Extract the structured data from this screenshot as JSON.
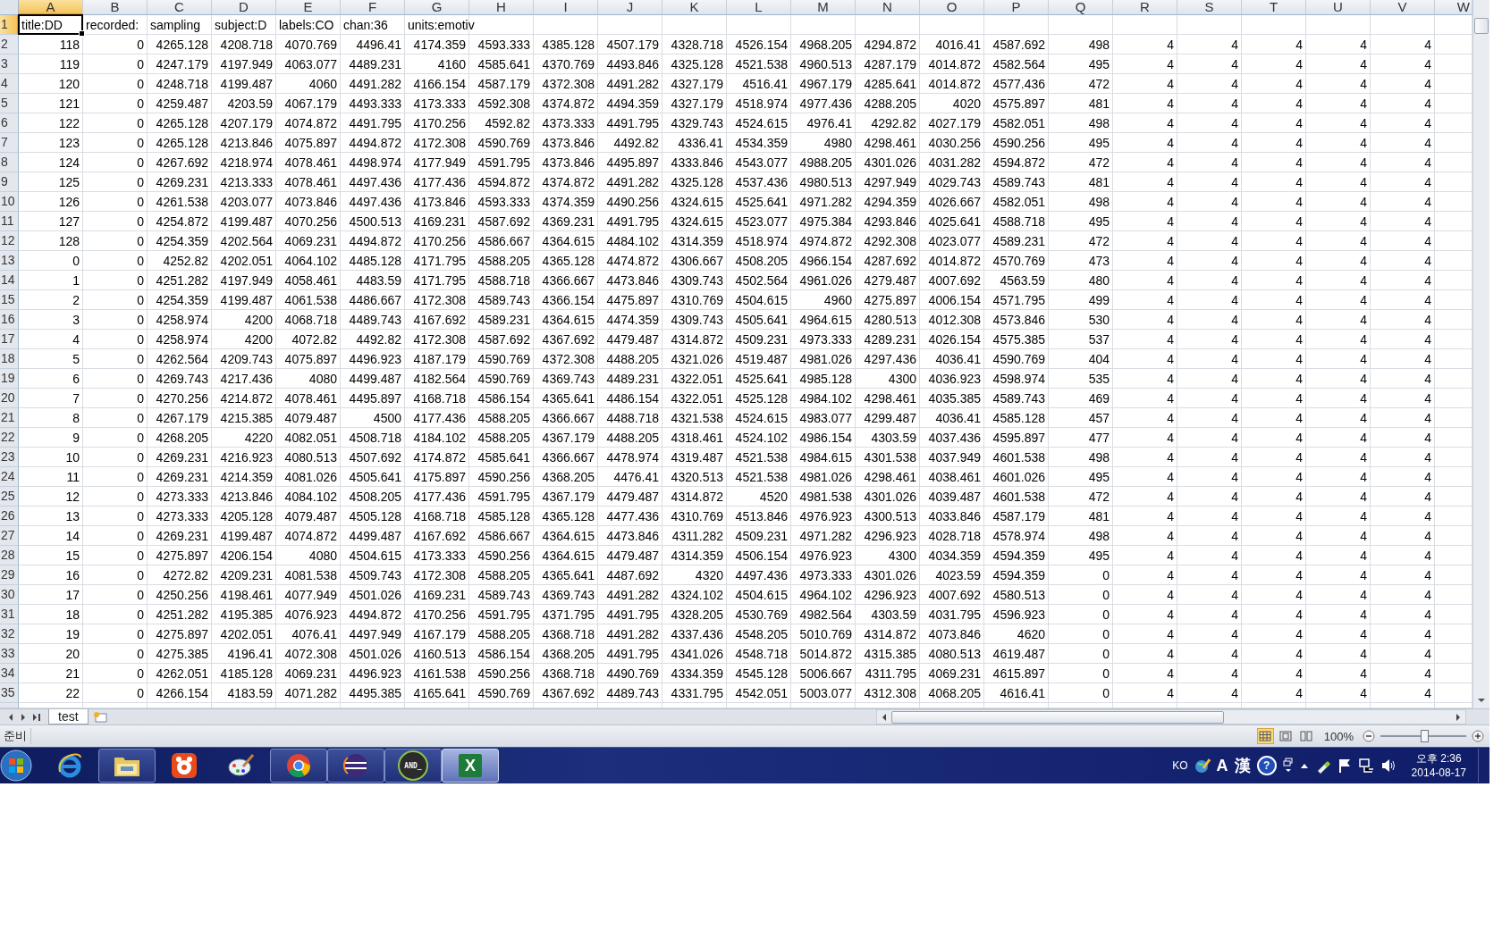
{
  "sheet": {
    "columns": [
      {
        "label": "A",
        "selected": true
      },
      {
        "label": "B",
        "selected": false
      },
      {
        "label": "C",
        "selected": false
      },
      {
        "label": "D",
        "selected": false
      },
      {
        "label": "E",
        "selected": false
      },
      {
        "label": "F",
        "selected": false
      },
      {
        "label": "G",
        "selected": false
      },
      {
        "label": "H",
        "selected": false
      },
      {
        "label": "I",
        "selected": false
      },
      {
        "label": "J",
        "selected": false
      },
      {
        "label": "K",
        "selected": false
      },
      {
        "label": "L",
        "selected": false
      },
      {
        "label": "M",
        "selected": false
      },
      {
        "label": "N",
        "selected": false
      },
      {
        "label": "O",
        "selected": false
      },
      {
        "label": "P",
        "selected": false
      },
      {
        "label": "Q",
        "selected": false
      },
      {
        "label": "R",
        "selected": false
      },
      {
        "label": "S",
        "selected": false
      },
      {
        "label": "T",
        "selected": false
      },
      {
        "label": "U",
        "selected": false
      },
      {
        "label": "V",
        "selected": false
      },
      {
        "label": "W",
        "selected": false
      }
    ],
    "rows": [
      {
        "label": "1",
        "selected": true,
        "kind": "text",
        "cells": [
          "title:DD",
          "recorded:",
          "sampling",
          "subject:D",
          "labels:CO",
          "chan:36",
          "units:emotiv"
        ]
      },
      {
        "label": "2",
        "selected": false,
        "kind": "number",
        "cells": [
          "118",
          "0",
          "4265.128",
          "4208.718",
          "4070.769",
          "4496.41",
          "4174.359",
          "4593.333",
          "4385.128",
          "4507.179",
          "4328.718",
          "4526.154",
          "4968.205",
          "4294.872",
          "4016.41",
          "4587.692",
          "498",
          "4",
          "4",
          "4",
          "4",
          "4"
        ]
      },
      {
        "label": "3",
        "selected": false,
        "kind": "number",
        "cells": [
          "119",
          "0",
          "4247.179",
          "4197.949",
          "4063.077",
          "4489.231",
          "4160",
          "4585.641",
          "4370.769",
          "4493.846",
          "4325.128",
          "4521.538",
          "4960.513",
          "4287.179",
          "4014.872",
          "4582.564",
          "495",
          "4",
          "4",
          "4",
          "4",
          "4"
        ]
      },
      {
        "label": "4",
        "selected": false,
        "kind": "number",
        "cells": [
          "120",
          "0",
          "4248.718",
          "4199.487",
          "4060",
          "4491.282",
          "4166.154",
          "4587.179",
          "4372.308",
          "4491.282",
          "4327.179",
          "4516.41",
          "4967.179",
          "4285.641",
          "4014.872",
          "4577.436",
          "472",
          "4",
          "4",
          "4",
          "4",
          "4"
        ]
      },
      {
        "label": "5",
        "selected": false,
        "kind": "number",
        "cells": [
          "121",
          "0",
          "4259.487",
          "4203.59",
          "4067.179",
          "4493.333",
          "4173.333",
          "4592.308",
          "4374.872",
          "4494.359",
          "4327.179",
          "4518.974",
          "4977.436",
          "4288.205",
          "4020",
          "4575.897",
          "481",
          "4",
          "4",
          "4",
          "4",
          "4"
        ]
      },
      {
        "label": "6",
        "selected": false,
        "kind": "number",
        "cells": [
          "122",
          "0",
          "4265.128",
          "4207.179",
          "4074.872",
          "4491.795",
          "4170.256",
          "4592.82",
          "4373.333",
          "4491.795",
          "4329.743",
          "4524.615",
          "4976.41",
          "4292.82",
          "4027.179",
          "4582.051",
          "498",
          "4",
          "4",
          "4",
          "4",
          "4"
        ]
      },
      {
        "label": "7",
        "selected": false,
        "kind": "number",
        "cells": [
          "123",
          "0",
          "4265.128",
          "4213.846",
          "4075.897",
          "4494.872",
          "4172.308",
          "4590.769",
          "4373.846",
          "4492.82",
          "4336.41",
          "4534.359",
          "4980",
          "4298.461",
          "4030.256",
          "4590.256",
          "495",
          "4",
          "4",
          "4",
          "4",
          "4"
        ]
      },
      {
        "label": "8",
        "selected": false,
        "kind": "number",
        "cells": [
          "124",
          "0",
          "4267.692",
          "4218.974",
          "4078.461",
          "4498.974",
          "4177.949",
          "4591.795",
          "4373.846",
          "4495.897",
          "4333.846",
          "4543.077",
          "4988.205",
          "4301.026",
          "4031.282",
          "4594.872",
          "472",
          "4",
          "4",
          "4",
          "4",
          "4"
        ]
      },
      {
        "label": "9",
        "selected": false,
        "kind": "number",
        "cells": [
          "125",
          "0",
          "4269.231",
          "4213.333",
          "4078.461",
          "4497.436",
          "4177.436",
          "4594.872",
          "4374.872",
          "4491.282",
          "4325.128",
          "4537.436",
          "4980.513",
          "4297.949",
          "4029.743",
          "4589.743",
          "481",
          "4",
          "4",
          "4",
          "4",
          "4"
        ]
      },
      {
        "label": "10",
        "selected": false,
        "kind": "number",
        "cells": [
          "126",
          "0",
          "4261.538",
          "4203.077",
          "4073.846",
          "4497.436",
          "4173.846",
          "4593.333",
          "4374.359",
          "4490.256",
          "4324.615",
          "4525.641",
          "4971.282",
          "4294.359",
          "4026.667",
          "4582.051",
          "498",
          "4",
          "4",
          "4",
          "4",
          "4"
        ]
      },
      {
        "label": "11",
        "selected": false,
        "kind": "number",
        "cells": [
          "127",
          "0",
          "4254.872",
          "4199.487",
          "4070.256",
          "4500.513",
          "4169.231",
          "4587.692",
          "4369.231",
          "4491.795",
          "4324.615",
          "4523.077",
          "4975.384",
          "4293.846",
          "4025.641",
          "4588.718",
          "495",
          "4",
          "4",
          "4",
          "4",
          "4"
        ]
      },
      {
        "label": "12",
        "selected": false,
        "kind": "number",
        "cells": [
          "128",
          "0",
          "4254.359",
          "4202.564",
          "4069.231",
          "4494.872",
          "4170.256",
          "4586.667",
          "4364.615",
          "4484.102",
          "4314.359",
          "4518.974",
          "4974.872",
          "4292.308",
          "4023.077",
          "4589.231",
          "472",
          "4",
          "4",
          "4",
          "4",
          "4"
        ]
      },
      {
        "label": "13",
        "selected": false,
        "kind": "number",
        "cells": [
          "0",
          "0",
          "4252.82",
          "4202.051",
          "4064.102",
          "4485.128",
          "4171.795",
          "4588.205",
          "4365.128",
          "4474.872",
          "4306.667",
          "4508.205",
          "4966.154",
          "4287.692",
          "4014.872",
          "4570.769",
          "473",
          "4",
          "4",
          "4",
          "4",
          "4"
        ]
      },
      {
        "label": "14",
        "selected": false,
        "kind": "number",
        "cells": [
          "1",
          "0",
          "4251.282",
          "4197.949",
          "4058.461",
          "4483.59",
          "4171.795",
          "4588.718",
          "4366.667",
          "4473.846",
          "4309.743",
          "4502.564",
          "4961.026",
          "4279.487",
          "4007.692",
          "4563.59",
          "480",
          "4",
          "4",
          "4",
          "4",
          "4"
        ]
      },
      {
        "label": "15",
        "selected": false,
        "kind": "number",
        "cells": [
          "2",
          "0",
          "4254.359",
          "4199.487",
          "4061.538",
          "4486.667",
          "4172.308",
          "4589.743",
          "4366.154",
          "4475.897",
          "4310.769",
          "4504.615",
          "4960",
          "4275.897",
          "4006.154",
          "4571.795",
          "499",
          "4",
          "4",
          "4",
          "4",
          "4"
        ]
      },
      {
        "label": "16",
        "selected": false,
        "kind": "number",
        "cells": [
          "3",
          "0",
          "4258.974",
          "4200",
          "4068.718",
          "4489.743",
          "4167.692",
          "4589.231",
          "4364.615",
          "4474.359",
          "4309.743",
          "4505.641",
          "4964.615",
          "4280.513",
          "4012.308",
          "4573.846",
          "530",
          "4",
          "4",
          "4",
          "4",
          "4"
        ]
      },
      {
        "label": "17",
        "selected": false,
        "kind": "number",
        "cells": [
          "4",
          "0",
          "4258.974",
          "4200",
          "4072.82",
          "4492.82",
          "4172.308",
          "4587.692",
          "4367.692",
          "4479.487",
          "4314.872",
          "4509.231",
          "4973.333",
          "4289.231",
          "4026.154",
          "4575.385",
          "537",
          "4",
          "4",
          "4",
          "4",
          "4"
        ]
      },
      {
        "label": "18",
        "selected": false,
        "kind": "number",
        "cells": [
          "5",
          "0",
          "4262.564",
          "4209.743",
          "4075.897",
          "4496.923",
          "4187.179",
          "4590.769",
          "4372.308",
          "4488.205",
          "4321.026",
          "4519.487",
          "4981.026",
          "4297.436",
          "4036.41",
          "4590.769",
          "404",
          "4",
          "4",
          "4",
          "4",
          "4"
        ]
      },
      {
        "label": "19",
        "selected": false,
        "kind": "number",
        "cells": [
          "6",
          "0",
          "4269.743",
          "4217.436",
          "4080",
          "4499.487",
          "4182.564",
          "4590.769",
          "4369.743",
          "4489.231",
          "4322.051",
          "4525.641",
          "4985.128",
          "4300",
          "4036.923",
          "4598.974",
          "535",
          "4",
          "4",
          "4",
          "4",
          "4"
        ]
      },
      {
        "label": "20",
        "selected": false,
        "kind": "number",
        "cells": [
          "7",
          "0",
          "4270.256",
          "4214.872",
          "4078.461",
          "4495.897",
          "4168.718",
          "4586.154",
          "4365.641",
          "4486.154",
          "4322.051",
          "4525.128",
          "4984.102",
          "4298.461",
          "4035.385",
          "4589.743",
          "469",
          "4",
          "4",
          "4",
          "4",
          "4"
        ]
      },
      {
        "label": "21",
        "selected": false,
        "kind": "number",
        "cells": [
          "8",
          "0",
          "4267.179",
          "4215.385",
          "4079.487",
          "4500",
          "4177.436",
          "4588.205",
          "4366.667",
          "4488.718",
          "4321.538",
          "4524.615",
          "4983.077",
          "4299.487",
          "4036.41",
          "4585.128",
          "457",
          "4",
          "4",
          "4",
          "4",
          "4"
        ]
      },
      {
        "label": "22",
        "selected": false,
        "kind": "number",
        "cells": [
          "9",
          "0",
          "4268.205",
          "4220",
          "4082.051",
          "4508.718",
          "4184.102",
          "4588.205",
          "4367.179",
          "4488.205",
          "4318.461",
          "4524.102",
          "4986.154",
          "4303.59",
          "4037.436",
          "4595.897",
          "477",
          "4",
          "4",
          "4",
          "4",
          "4"
        ]
      },
      {
        "label": "23",
        "selected": false,
        "kind": "number",
        "cells": [
          "10",
          "0",
          "4269.231",
          "4216.923",
          "4080.513",
          "4507.692",
          "4174.872",
          "4585.641",
          "4366.667",
          "4478.974",
          "4319.487",
          "4521.538",
          "4984.615",
          "4301.538",
          "4037.949",
          "4601.538",
          "498",
          "4",
          "4",
          "4",
          "4",
          "4"
        ]
      },
      {
        "label": "24",
        "selected": false,
        "kind": "number",
        "cells": [
          "11",
          "0",
          "4269.231",
          "4214.359",
          "4081.026",
          "4505.641",
          "4175.897",
          "4590.256",
          "4368.205",
          "4476.41",
          "4320.513",
          "4521.538",
          "4981.026",
          "4298.461",
          "4038.461",
          "4601.026",
          "495",
          "4",
          "4",
          "4",
          "4",
          "4"
        ]
      },
      {
        "label": "25",
        "selected": false,
        "kind": "number",
        "cells": [
          "12",
          "0",
          "4273.333",
          "4213.846",
          "4084.102",
          "4508.205",
          "4177.436",
          "4591.795",
          "4367.179",
          "4479.487",
          "4314.872",
          "4520",
          "4981.538",
          "4301.026",
          "4039.487",
          "4601.538",
          "472",
          "4",
          "4",
          "4",
          "4",
          "4"
        ]
      },
      {
        "label": "26",
        "selected": false,
        "kind": "number",
        "cells": [
          "13",
          "0",
          "4273.333",
          "4205.128",
          "4079.487",
          "4505.128",
          "4168.718",
          "4585.128",
          "4365.128",
          "4477.436",
          "4310.769",
          "4513.846",
          "4976.923",
          "4300.513",
          "4033.846",
          "4587.179",
          "481",
          "4",
          "4",
          "4",
          "4",
          "4"
        ]
      },
      {
        "label": "27",
        "selected": false,
        "kind": "number",
        "cells": [
          "14",
          "0",
          "4269.231",
          "4199.487",
          "4074.872",
          "4499.487",
          "4167.692",
          "4586.667",
          "4364.615",
          "4473.846",
          "4311.282",
          "4509.231",
          "4971.282",
          "4296.923",
          "4028.718",
          "4578.974",
          "498",
          "4",
          "4",
          "4",
          "4",
          "4"
        ]
      },
      {
        "label": "28",
        "selected": false,
        "kind": "number",
        "cells": [
          "15",
          "0",
          "4275.897",
          "4206.154",
          "4080",
          "4504.615",
          "4173.333",
          "4590.256",
          "4364.615",
          "4479.487",
          "4314.359",
          "4506.154",
          "4976.923",
          "4300",
          "4034.359",
          "4594.359",
          "495",
          "4",
          "4",
          "4",
          "4",
          "4"
        ]
      },
      {
        "label": "29",
        "selected": false,
        "kind": "number",
        "cells": [
          "16",
          "0",
          "4272.82",
          "4209.231",
          "4081.538",
          "4509.743",
          "4172.308",
          "4588.205",
          "4365.641",
          "4487.692",
          "4320",
          "4497.436",
          "4973.333",
          "4301.026",
          "4023.59",
          "4594.359",
          "0",
          "4",
          "4",
          "4",
          "4",
          "4"
        ]
      },
      {
        "label": "30",
        "selected": false,
        "kind": "number",
        "cells": [
          "17",
          "0",
          "4250.256",
          "4198.461",
          "4077.949",
          "4501.026",
          "4169.231",
          "4589.743",
          "4369.743",
          "4491.282",
          "4324.102",
          "4504.615",
          "4964.102",
          "4296.923",
          "4007.692",
          "4580.513",
          "0",
          "4",
          "4",
          "4",
          "4",
          "4"
        ]
      },
      {
        "label": "31",
        "selected": false,
        "kind": "number",
        "cells": [
          "18",
          "0",
          "4251.282",
          "4195.385",
          "4076.923",
          "4494.872",
          "4170.256",
          "4591.795",
          "4371.795",
          "4491.795",
          "4328.205",
          "4530.769",
          "4982.564",
          "4303.59",
          "4031.795",
          "4596.923",
          "0",
          "4",
          "4",
          "4",
          "4",
          "4"
        ]
      },
      {
        "label": "32",
        "selected": false,
        "kind": "number",
        "cells": [
          "19",
          "0",
          "4275.897",
          "4202.051",
          "4076.41",
          "4497.949",
          "4167.179",
          "4588.205",
          "4368.718",
          "4491.282",
          "4337.436",
          "4548.205",
          "5010.769",
          "4314.872",
          "4073.846",
          "4620",
          "0",
          "4",
          "4",
          "4",
          "4",
          "4"
        ]
      },
      {
        "label": "33",
        "selected": false,
        "kind": "number",
        "cells": [
          "20",
          "0",
          "4275.385",
          "4196.41",
          "4072.308",
          "4501.026",
          "4160.513",
          "4586.154",
          "4368.205",
          "4491.795",
          "4341.026",
          "4548.718",
          "5014.872",
          "4315.385",
          "4080.513",
          "4619.487",
          "0",
          "4",
          "4",
          "4",
          "4",
          "4"
        ]
      },
      {
        "label": "34",
        "selected": false,
        "kind": "number",
        "cells": [
          "21",
          "0",
          "4262.051",
          "4185.128",
          "4069.231",
          "4496.923",
          "4161.538",
          "4590.256",
          "4368.718",
          "4490.769",
          "4334.359",
          "4545.128",
          "5006.667",
          "4311.795",
          "4069.231",
          "4615.897",
          "0",
          "4",
          "4",
          "4",
          "4",
          "4"
        ]
      },
      {
        "label": "35",
        "selected": false,
        "kind": "number",
        "cells": [
          "22",
          "0",
          "4266.154",
          "4183.59",
          "4071.282",
          "4495.385",
          "4165.641",
          "4590.769",
          "4367.692",
          "4489.743",
          "4331.795",
          "4542.051",
          "5003.077",
          "4312.308",
          "4068.205",
          "4616.41",
          "0",
          "4",
          "4",
          "4",
          "4",
          "4"
        ]
      }
    ]
  },
  "sheet_tabs": [
    {
      "label": "test",
      "selected": true
    }
  ],
  "status_bar": {
    "text": "준비",
    "view_modes": [
      {
        "kind": "normal",
        "selected": true
      },
      {
        "kind": "page-layout",
        "selected": false
      },
      {
        "kind": "page-break",
        "selected": false
      }
    ],
    "zoom": "100%",
    "zoom_slider": {
      "level": 0.5
    }
  },
  "taskbar": {
    "apps": [
      {
        "kind": "ie",
        "running": false,
        "active": false
      },
      {
        "kind": "folder",
        "running": true,
        "active": false
      },
      {
        "kind": "player",
        "running": false,
        "active": false
      },
      {
        "kind": "paint",
        "running": false,
        "active": false
      },
      {
        "kind": "chrome",
        "running": true,
        "active": false
      },
      {
        "kind": "eclipse",
        "running": true,
        "active": false
      },
      {
        "kind": "terminal",
        "running": true,
        "active": false,
        "text": "AND_"
      },
      {
        "kind": "excel",
        "running": true,
        "active": true,
        "text": "X"
      }
    ],
    "tray": {
      "language": "KO",
      "input_mode": "A",
      "hanja": "漢",
      "help": "?"
    },
    "clock": {
      "time": "오후 2:36",
      "date": "2014-08-17"
    }
  }
}
